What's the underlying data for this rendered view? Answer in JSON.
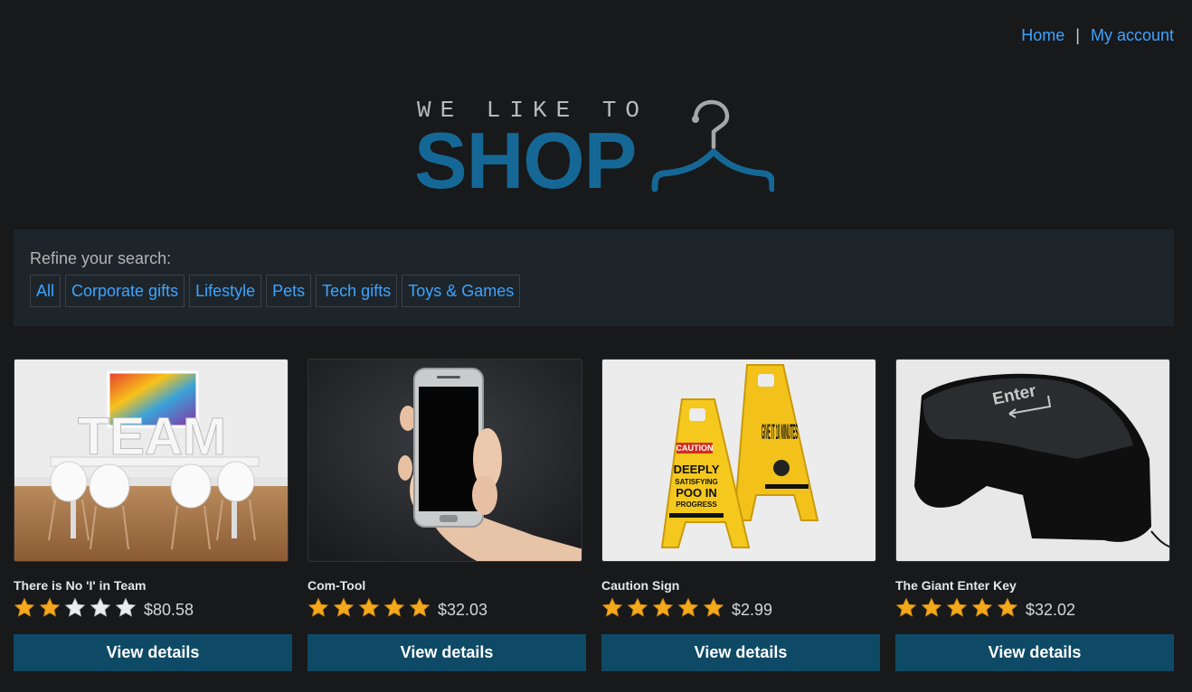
{
  "nav": {
    "home_label": "Home",
    "separator": "|",
    "account_label": "My account"
  },
  "logo": {
    "tagline": "WE LIKE TO",
    "wordmark": "SHOP",
    "icon": "coat-hanger-icon",
    "brand_color": "#156895"
  },
  "filters": {
    "label": "Refine your search:",
    "categories": [
      "All",
      "Corporate gifts",
      "Lifestyle",
      "Pets",
      "Tech gifts",
      "Toys & Games"
    ]
  },
  "products": [
    {
      "title": "There is No 'I' in Team",
      "rating": 2,
      "max_rating": 5,
      "price": "$80.58",
      "button": "View details",
      "image": "team-meeting-room-photo"
    },
    {
      "title": "Com-Tool",
      "rating": 5,
      "max_rating": 5,
      "price": "$32.03",
      "button": "View details",
      "image": "hand-holding-phone-photo"
    },
    {
      "title": "Caution Sign",
      "rating": 5,
      "max_rating": 5,
      "price": "$2.99",
      "button": "View details",
      "image": "caution-signs-photo"
    },
    {
      "title": "The Giant Enter Key",
      "rating": 5,
      "max_rating": 5,
      "price": "$32.02",
      "button": "View details",
      "image": "giant-enter-key-photo"
    }
  ],
  "image_labels": {
    "team_word": "TEAM",
    "sign_caution": "CAUTION",
    "sign_text": "DEEPLY SATISFYING POO IN PROGRESS",
    "sign2_text": "GIVE IT 10 MINUTES",
    "key_label": "Enter"
  },
  "colors": {
    "background": "#18191b",
    "link": "#3da4ff",
    "star_filled": "#f4a81b",
    "star_empty": "#ececec",
    "button_bg": "#0e4a66",
    "filter_bg": "#1d252b"
  }
}
